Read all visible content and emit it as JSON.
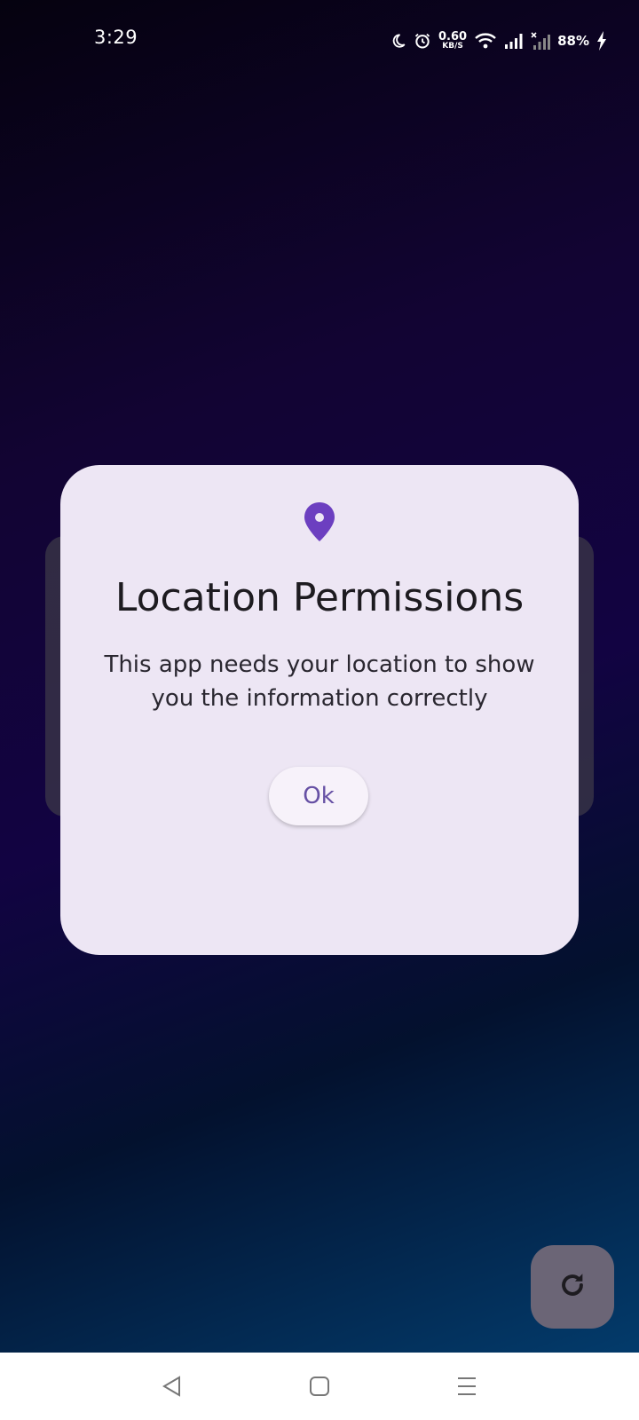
{
  "status_bar": {
    "time": "3:29",
    "net_speed_value": "0.60",
    "net_speed_unit": "KB/S",
    "battery": "88%",
    "icons": [
      "moon-icon",
      "alarm-icon",
      "wifi-icon",
      "signal-icon",
      "signal-x-icon",
      "charging-icon"
    ]
  },
  "dialog": {
    "icon": "location-pin-icon",
    "title": "Location Permissions",
    "body": "This app needs your location to show\nyou the information correctly",
    "ok_label": "Ok"
  },
  "fab": {
    "icon": "refresh-icon"
  },
  "nav_bar": {
    "icons": [
      "back-icon",
      "home-icon",
      "recents-icon"
    ]
  },
  "colors": {
    "dialog_background": "#ede6f4",
    "accent": "#6c3fc0",
    "button_text": "#6650a4",
    "fab_background": "#6b6576"
  }
}
